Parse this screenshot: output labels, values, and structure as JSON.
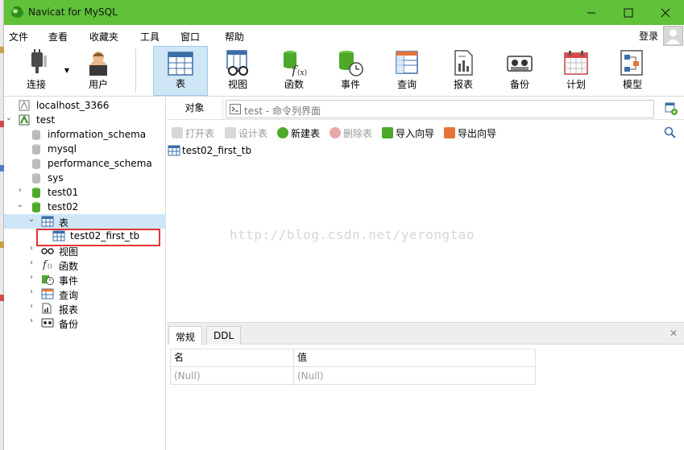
{
  "window": {
    "title": "Navicat for MySQL"
  },
  "menu": {
    "items": [
      "文件",
      "查看",
      "收藏夹",
      "工具",
      "窗口",
      "帮助"
    ],
    "login": "登录"
  },
  "toolbar": {
    "items": [
      {
        "label": "连接",
        "icon": "plug-icon"
      },
      {
        "label": "用户",
        "icon": "user-icon"
      },
      {
        "label": "表",
        "icon": "table-icon",
        "active": true
      },
      {
        "label": "视图",
        "icon": "view-icon"
      },
      {
        "label": "函数",
        "icon": "function-icon"
      },
      {
        "label": "事件",
        "icon": "event-icon"
      },
      {
        "label": "查询",
        "icon": "query-icon"
      },
      {
        "label": "报表",
        "icon": "report-icon"
      },
      {
        "label": "备份",
        "icon": "backup-icon"
      },
      {
        "label": "计划",
        "icon": "schedule-icon"
      },
      {
        "label": "模型",
        "icon": "model-icon"
      }
    ]
  },
  "tree": {
    "nodes": [
      {
        "label": "localhost_3366"
      },
      {
        "label": "test"
      },
      {
        "label": "information_schema"
      },
      {
        "label": "mysql"
      },
      {
        "label": "performance_schema"
      },
      {
        "label": "sys"
      },
      {
        "label": "test01"
      },
      {
        "label": "test02"
      },
      {
        "label": "表"
      },
      {
        "label": "test02_first_tb"
      },
      {
        "label": "视图"
      },
      {
        "label": "函数"
      },
      {
        "label": "事件"
      },
      {
        "label": "查询"
      },
      {
        "label": "报表"
      },
      {
        "label": "备份"
      }
    ]
  },
  "objects": {
    "tab_label": "对象",
    "cmd_tab": "test - 命令列界面",
    "actions": [
      "打开表",
      "设计表",
      "新建表",
      "删除表",
      "导入向导",
      "导出向导"
    ],
    "items": [
      "test02_first_tb"
    ]
  },
  "watermark": "http://blog.csdn.net/yerongtao",
  "info_panel": {
    "tabs": [
      "常规",
      "DDL"
    ],
    "columns": [
      "名",
      "值"
    ],
    "row": [
      "(Null)",
      "(Null)"
    ]
  },
  "colors": {
    "titlebar": "#5fc238",
    "selected": "#cfe6f7",
    "highlight_box": "#e53535"
  }
}
